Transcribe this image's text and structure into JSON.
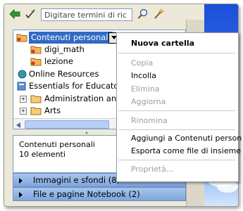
{
  "search": {
    "value": "Digitare termini di ric"
  },
  "tree": {
    "items": [
      {
        "label": "Contenuti personali"
      },
      {
        "label": "digi_math"
      },
      {
        "label": "lezione"
      },
      {
        "label": "Online Resources"
      },
      {
        "label": "Essentials for Educators"
      },
      {
        "label": "Administration and"
      },
      {
        "label": "Arts"
      }
    ]
  },
  "info": {
    "title": "Contenuti personali",
    "count": "10 elementi"
  },
  "categories": [
    {
      "label": "Immagini e sfondi (8)"
    },
    {
      "label": "File e pagine Notebook (2)"
    }
  ],
  "menu": {
    "items": [
      {
        "label": "Nuova cartella",
        "enabled": true
      },
      {
        "label": "Copia",
        "enabled": false
      },
      {
        "label": "Incolla",
        "enabled": true
      },
      {
        "label": "Elimina",
        "enabled": false
      },
      {
        "label": "Aggiorna",
        "enabled": false
      },
      {
        "label": "Rinomina",
        "enabled": false
      },
      {
        "label": "Aggiungi a Contenuti person",
        "enabled": true
      },
      {
        "label": "Esporta come file di insieme",
        "enabled": true
      },
      {
        "label": "Proprietà...",
        "enabled": false
      }
    ]
  },
  "colors": {
    "selection": "#316ac5",
    "category_bar": "#7ea5dc",
    "panel_border": "#7f9db9"
  }
}
